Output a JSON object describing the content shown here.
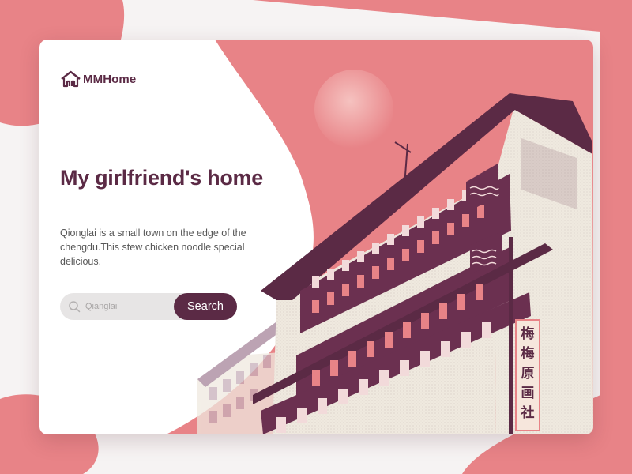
{
  "brand": {
    "name": "MMHome",
    "icon": "house-logo-icon"
  },
  "hero": {
    "title": "My girlfriend's home",
    "description": "Qionglai is a small town on the edge of the chengdu.This stew chicken noodle special delicious."
  },
  "search": {
    "placeholder": "Qianglai",
    "button_label": "Search",
    "icon": "search-icon"
  },
  "illustration": {
    "subject": "old-wooden-building",
    "sign_chars": [
      "梅",
      "梅",
      "原",
      "画",
      "社"
    ]
  },
  "colors": {
    "accent": "#5b2a45",
    "pink": "#e88387",
    "background": "#f6f3f3",
    "cream": "#efe9df"
  }
}
